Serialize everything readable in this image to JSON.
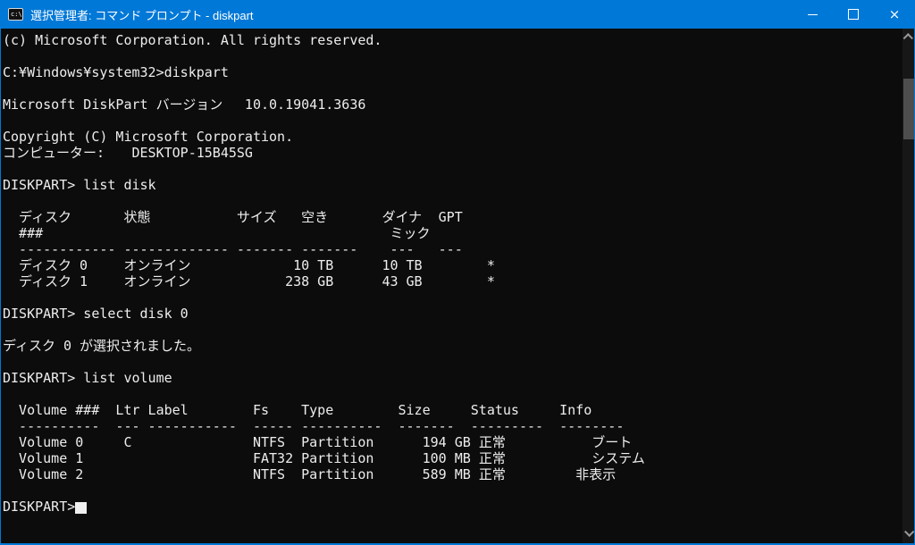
{
  "titlebar": {
    "title": "選択管理者: コマンド プロンプト - diskpart",
    "app_icon_text": "c:\\",
    "close_glyph": "×",
    "icons": {
      "app": "cmd-icon",
      "minimize": "minimize-icon",
      "maximize": "maximize-icon",
      "close": "close-icon"
    }
  },
  "colors": {
    "titlebar_bg": "#0078d7",
    "console_bg": "#0c0c0c",
    "console_text": "#ededed",
    "frame_border": "#0078d7",
    "scrollbar_thumb": "#4d4d4d"
  },
  "console": {
    "prompt": "DISKPART>",
    "lines": [
      {
        "row": 0,
        "segments": [
          [
            0,
            "(c) Microsoft Corporation. All rights reserved."
          ]
        ]
      },
      {
        "row": 2,
        "segments": [
          [
            0,
            "C:¥Windows¥system32>diskpart"
          ]
        ]
      },
      {
        "row": 4,
        "segments": [
          [
            0,
            "Microsoft DiskPart"
          ],
          [
            19,
            "バージョン"
          ],
          [
            30,
            "10.0.19041.3636"
          ]
        ]
      },
      {
        "row": 6,
        "segments": [
          [
            0,
            "Copyright (C) Microsoft Corporation."
          ]
        ]
      },
      {
        "row": 7,
        "segments": [
          [
            0,
            "コンピューター:"
          ],
          [
            16,
            "DESKTOP-15B45SG"
          ]
        ]
      },
      {
        "row": 9,
        "segments": [
          [
            0,
            "DISKPART> list disk"
          ]
        ]
      },
      {
        "row": 11,
        "segments": [
          [
            2,
            "ディスク"
          ],
          [
            15,
            "状態"
          ],
          [
            29,
            "サイズ"
          ],
          [
            37,
            "空き"
          ],
          [
            47,
            "ダイナ"
          ],
          [
            54,
            "GPT"
          ]
        ]
      },
      {
        "row": 12,
        "segments": [
          [
            2,
            "###"
          ],
          [
            48,
            "ミック"
          ]
        ]
      },
      {
        "row": 13,
        "segments": [
          [
            2,
            "------------"
          ],
          [
            15,
            "-------------"
          ],
          [
            29,
            "-------"
          ],
          [
            37,
            "-------"
          ],
          [
            48,
            "---"
          ],
          [
            54,
            "---"
          ]
        ]
      },
      {
        "row": 14,
        "segments": [
          [
            2,
            "ディスク 0"
          ],
          [
            15,
            "オンライン"
          ],
          [
            36,
            "10 TB"
          ],
          [
            47,
            "10 TB"
          ],
          [
            60,
            "*"
          ]
        ]
      },
      {
        "row": 15,
        "segments": [
          [
            2,
            "ディスク 1"
          ],
          [
            15,
            "オンライン"
          ],
          [
            35,
            "238 GB"
          ],
          [
            47,
            "43 GB"
          ],
          [
            60,
            "*"
          ]
        ]
      },
      {
        "row": 17,
        "segments": [
          [
            0,
            "DISKPART> select disk 0"
          ]
        ]
      },
      {
        "row": 19,
        "segments": [
          [
            0,
            "ディスク 0 が選択されました。"
          ]
        ]
      },
      {
        "row": 21,
        "segments": [
          [
            0,
            "DISKPART> list volume"
          ]
        ]
      },
      {
        "row": 23,
        "segments": [
          [
            2,
            "Volume ###"
          ],
          [
            14,
            "Ltr"
          ],
          [
            18,
            "Label"
          ],
          [
            31,
            "Fs"
          ],
          [
            37,
            "Type"
          ],
          [
            49,
            "Size"
          ],
          [
            58,
            "Status"
          ],
          [
            69,
            "Info"
          ]
        ]
      },
      {
        "row": 24,
        "segments": [
          [
            2,
            "----------"
          ],
          [
            14,
            "---"
          ],
          [
            18,
            "-----------"
          ],
          [
            31,
            "-----"
          ],
          [
            37,
            "----------"
          ],
          [
            49,
            "-------"
          ],
          [
            58,
            "---------"
          ],
          [
            69,
            "--------"
          ]
        ]
      },
      {
        "row": 25,
        "segments": [
          [
            2,
            "Volume 0"
          ],
          [
            15,
            "C"
          ],
          [
            31,
            "NTFS"
          ],
          [
            37,
            "Partition"
          ],
          [
            52,
            "194 GB"
          ],
          [
            59,
            "正常"
          ],
          [
            73,
            "ブート"
          ]
        ]
      },
      {
        "row": 26,
        "segments": [
          [
            2,
            "Volume 1"
          ],
          [
            31,
            "FAT32"
          ],
          [
            37,
            "Partition"
          ],
          [
            52,
            "100 MB"
          ],
          [
            59,
            "正常"
          ],
          [
            73,
            "システム"
          ]
        ]
      },
      {
        "row": 27,
        "segments": [
          [
            2,
            "Volume 2"
          ],
          [
            31,
            "NTFS"
          ],
          [
            37,
            "Partition"
          ],
          [
            52,
            "589 MB"
          ],
          [
            59,
            "正常"
          ],
          [
            71,
            "非表示"
          ]
        ]
      },
      {
        "row": 29,
        "segments": [
          [
            0,
            "DISKPART>"
          ]
        ]
      }
    ],
    "tables": {
      "list_disk": {
        "type": "table",
        "headers": [
          "ディスク ###",
          "状態",
          "サイズ",
          "空き",
          "ダイナミック",
          "GPT"
        ],
        "rows": [
          [
            "ディスク 0",
            "オンライン",
            "10 TB",
            "10 TB",
            "",
            "*"
          ],
          [
            "ディスク 1",
            "オンライン",
            "238 GB",
            "43 GB",
            "",
            "*"
          ]
        ]
      },
      "list_volume": {
        "type": "table",
        "headers": [
          "Volume ###",
          "Ltr",
          "Label",
          "Fs",
          "Type",
          "Size",
          "Status",
          "Info"
        ],
        "rows": [
          [
            "Volume 0",
            "C",
            "",
            "NTFS",
            "Partition",
            "194 GB",
            "正常",
            "ブート"
          ],
          [
            "Volume 1",
            "",
            "",
            "FAT32",
            "Partition",
            "100 MB",
            "正常",
            "システム"
          ],
          [
            "Volume 2",
            "",
            "",
            "NTFS",
            "Partition",
            "589 MB",
            "正常",
            "非表示"
          ]
        ]
      }
    }
  },
  "scrollbar": {
    "up_icon": "chevron-up-icon",
    "down_icon": "chevron-down-icon"
  }
}
